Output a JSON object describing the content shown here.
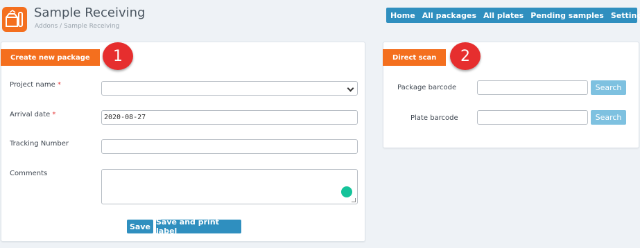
{
  "header": {
    "title": "Sample Receiving",
    "breadcrumb": "Addons / Sample Receiving",
    "logo_icon": "sample-receiving-logo-icon"
  },
  "nav": {
    "items": [
      "Home",
      "All packages",
      "All plates",
      "Pending samples",
      "Settings"
    ]
  },
  "create_panel": {
    "tab_label": "Create new package",
    "badge": "1",
    "project_name_label": "Project name",
    "arrival_date_label": "Arrival date",
    "arrival_date_value": "2020-08-27",
    "tracking_label": "Tracking Number",
    "comments_label": "Comments",
    "required_mark": "*",
    "save_label": "Save",
    "save_print_label": "Save and print label"
  },
  "scan_panel": {
    "tab_label": "Direct scan",
    "badge": "2",
    "package_barcode_label": "Package barcode",
    "plate_barcode_label": "Plate barcode",
    "search_label": "Search"
  },
  "colors": {
    "accent_orange": "#f46f1e",
    "nav_blue": "#2f8fbf",
    "badge_red": "#e62e2e",
    "grammarly_green": "#15c39a"
  }
}
